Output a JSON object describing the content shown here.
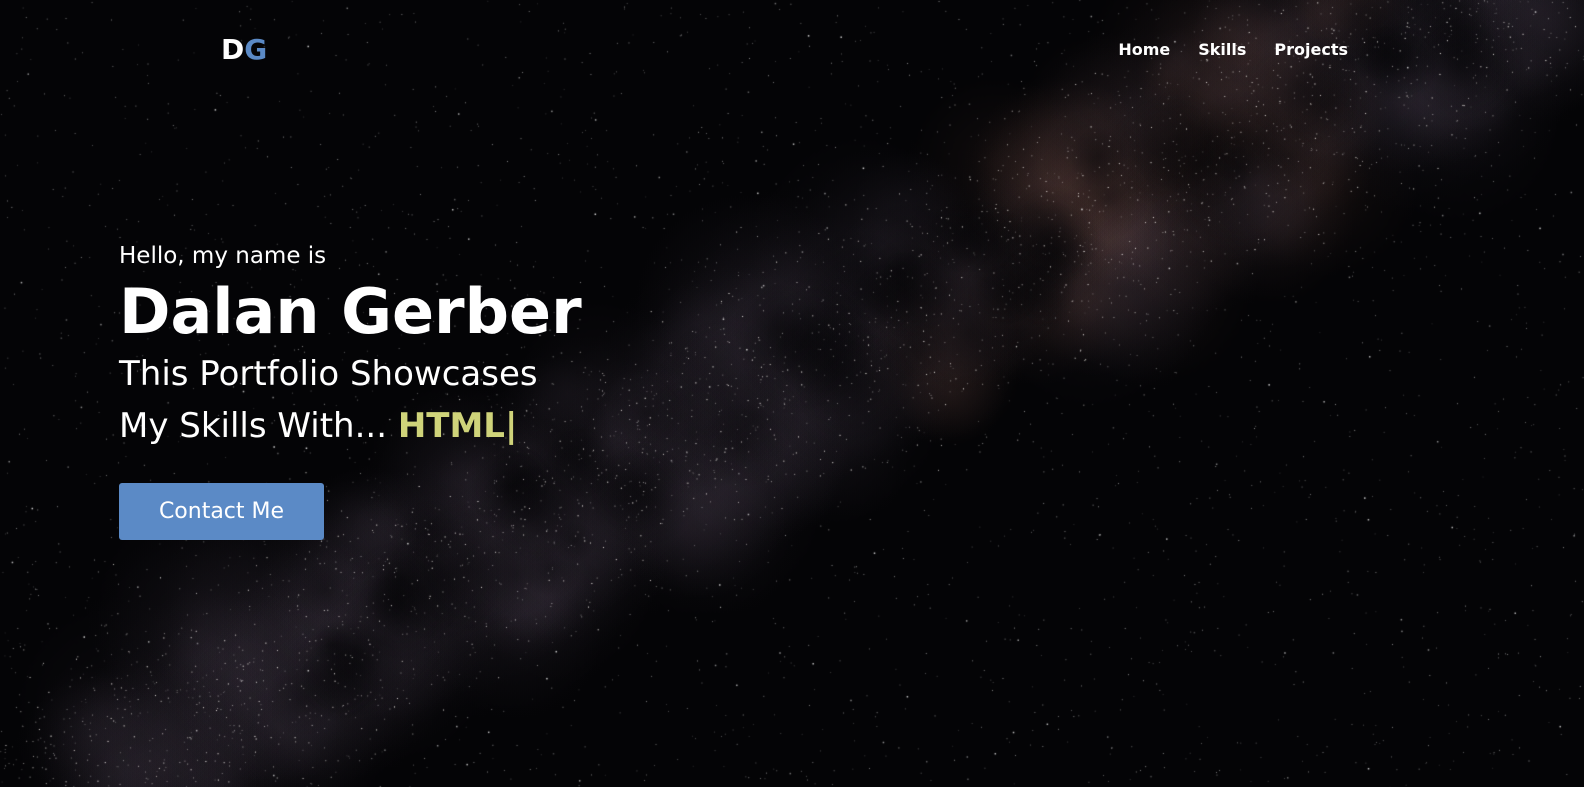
{
  "brand": {
    "logo_letter_1": "D",
    "logo_letter_2": "G",
    "accent_color": "#5b8ac6"
  },
  "nav": {
    "items": [
      {
        "label": "Home"
      },
      {
        "label": "Skills"
      },
      {
        "label": "Projects"
      }
    ]
  },
  "hero": {
    "greeting": "Hello, my name is",
    "name": "Dalan Gerber",
    "tagline_line1": "This Portfolio Showcases",
    "tagline_line2_prefix": "My Skills With...",
    "typed_word": "HTML",
    "cursor_char": "|",
    "highlight_color": "#cfd37a"
  },
  "cta": {
    "contact_label": "Contact Me"
  }
}
